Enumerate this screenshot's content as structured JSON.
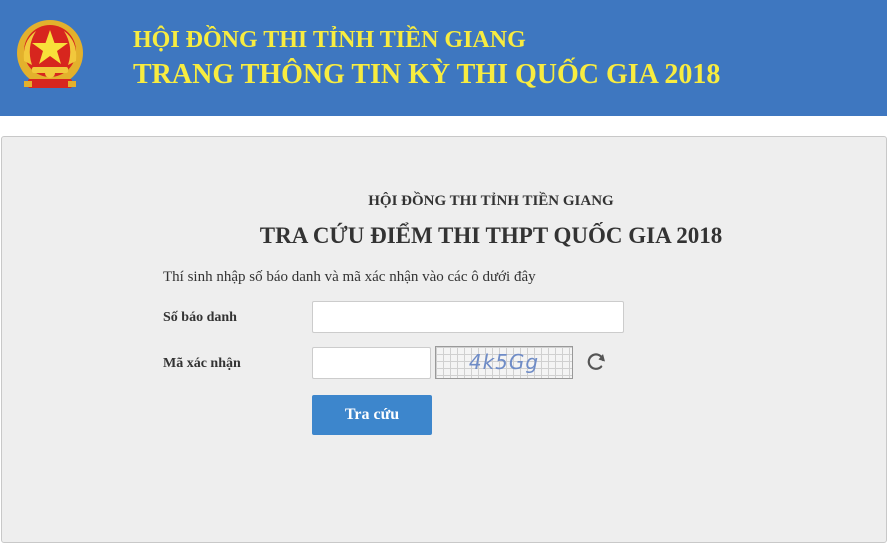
{
  "header": {
    "title": "HỘI ĐỒNG THI TỈNH TIỀN GIANG",
    "subtitle": "TRANG THÔNG TIN KỲ THI QUỐC GIA 2018",
    "background_color": "#3e77c0",
    "text_color": "#f8ec40",
    "emblem_icon": "vietnam-national-emblem-icon"
  },
  "form": {
    "council_name": "HỘI ĐỒNG THI TỈNH TIỀN GIANG",
    "heading": "TRA CỨU ĐIỂM THI THPT QUỐC GIA 2018",
    "instructions": "Thí sinh nhập số báo danh và mã xác nhận vào các ô dưới đây",
    "registration_label": "Số báo danh",
    "registration_value": "",
    "captcha_label": "Mã xác nhận",
    "captcha_value": "",
    "captcha_text": "4k5Gg",
    "refresh_icon": "refresh-icon",
    "submit_label": "Tra cứu",
    "button_color": "#3d86cc"
  }
}
